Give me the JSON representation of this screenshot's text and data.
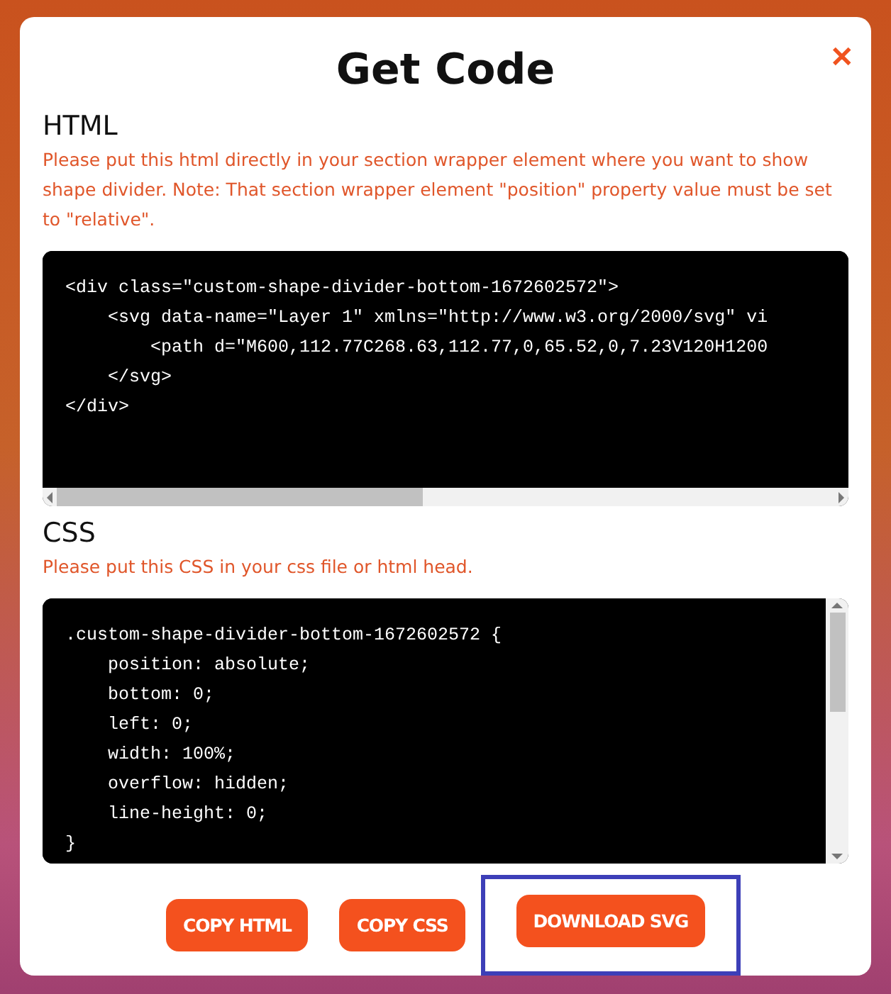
{
  "dialog": {
    "title": "Get Code",
    "close": "✕",
    "sections": [
      {
        "heading": "HTML",
        "note": "Please put this html directly in your section wrapper element where you want to show shape divider. Note: That section wrapper element \"position\" property value must be set to \"relative\".",
        "kind": "horizontal_scroll",
        "code": [
          "<div class=\"custom-shape-divider-bottom-1672602572\">",
          "    <svg data-name=\"Layer 1\" xmlns=\"http://www.w3.org/2000/svg\" vi",
          "        <path d=\"M600,112.77C268.63,112.77,0,65.52,0,7.23V120H1200",
          "    </svg>",
          "</div>"
        ]
      },
      {
        "heading": "CSS",
        "note": "Please put this CSS in your css file or html head.",
        "kind": "vertical_scroll",
        "code": [
          ".custom-shape-divider-bottom-1672602572 {",
          "    position: absolute;",
          "    bottom: 0;",
          "    left: 0;",
          "    width: 100%;",
          "    overflow: hidden;",
          "    line-height: 0;",
          "}"
        ]
      }
    ],
    "buttons": [
      {
        "label": "COPY HTML",
        "highlighted": false
      },
      {
        "label": "COPY CSS",
        "highlighted": false
      },
      {
        "label": "DOWNLOAD SVG",
        "highlighted": true
      }
    ]
  }
}
